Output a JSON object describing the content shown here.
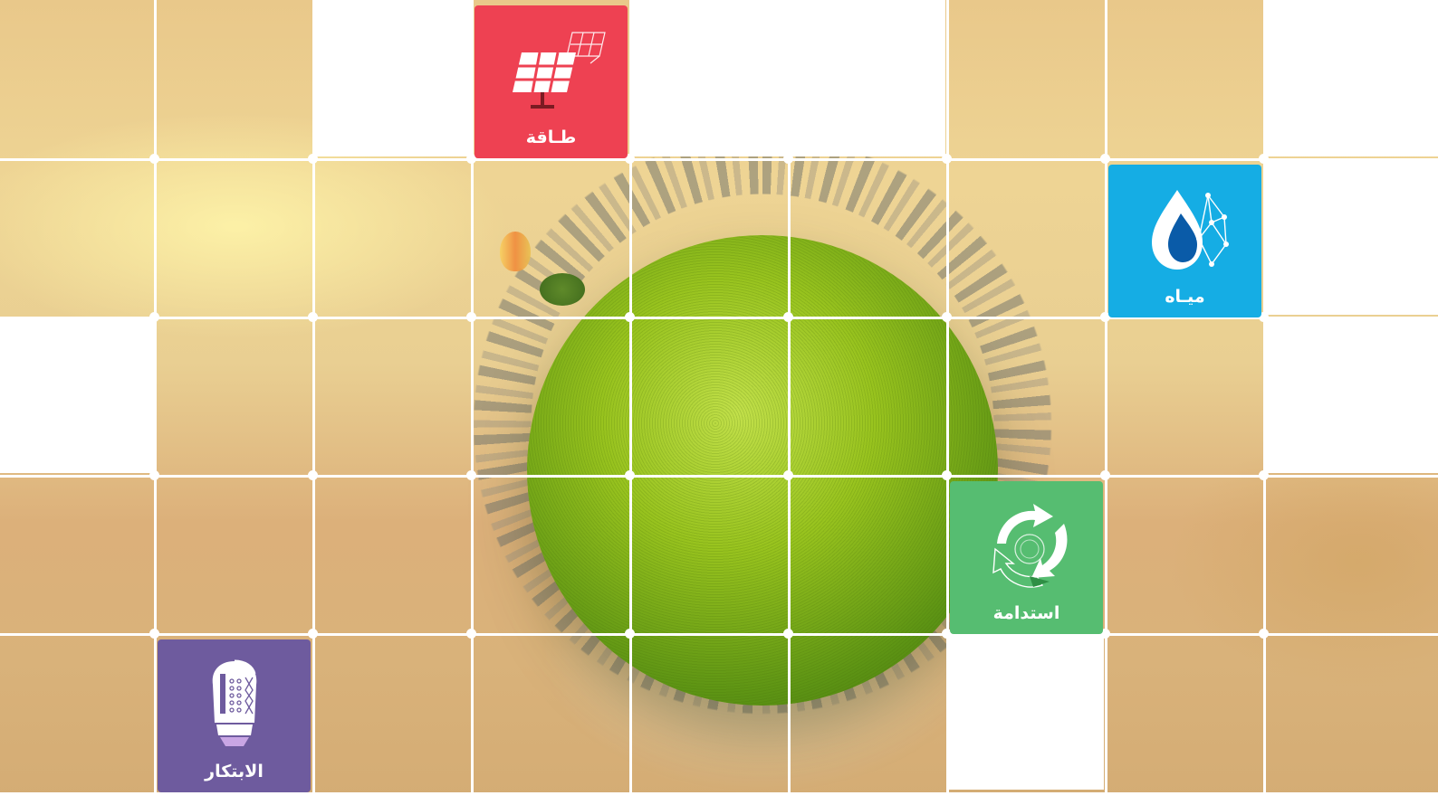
{
  "tiles": {
    "energy": {
      "label": "طـاقة",
      "icon": "solar-panel-icon",
      "color": "#ee4152"
    },
    "water": {
      "label": "ميـاه",
      "icon": "water-drop-icon",
      "color": "#15ade4"
    },
    "sustainability": {
      "label": "استدامة",
      "icon": "recycle-icon",
      "color": "#56bd71"
    },
    "innovation": {
      "label": "الابتكار",
      "icon": "light-bulb-icon",
      "color": "#6e5b9e"
    }
  },
  "background": {
    "tone_light": "#eed494",
    "tone_dark": "#d4ac74",
    "planet_green": "#98c31e"
  }
}
